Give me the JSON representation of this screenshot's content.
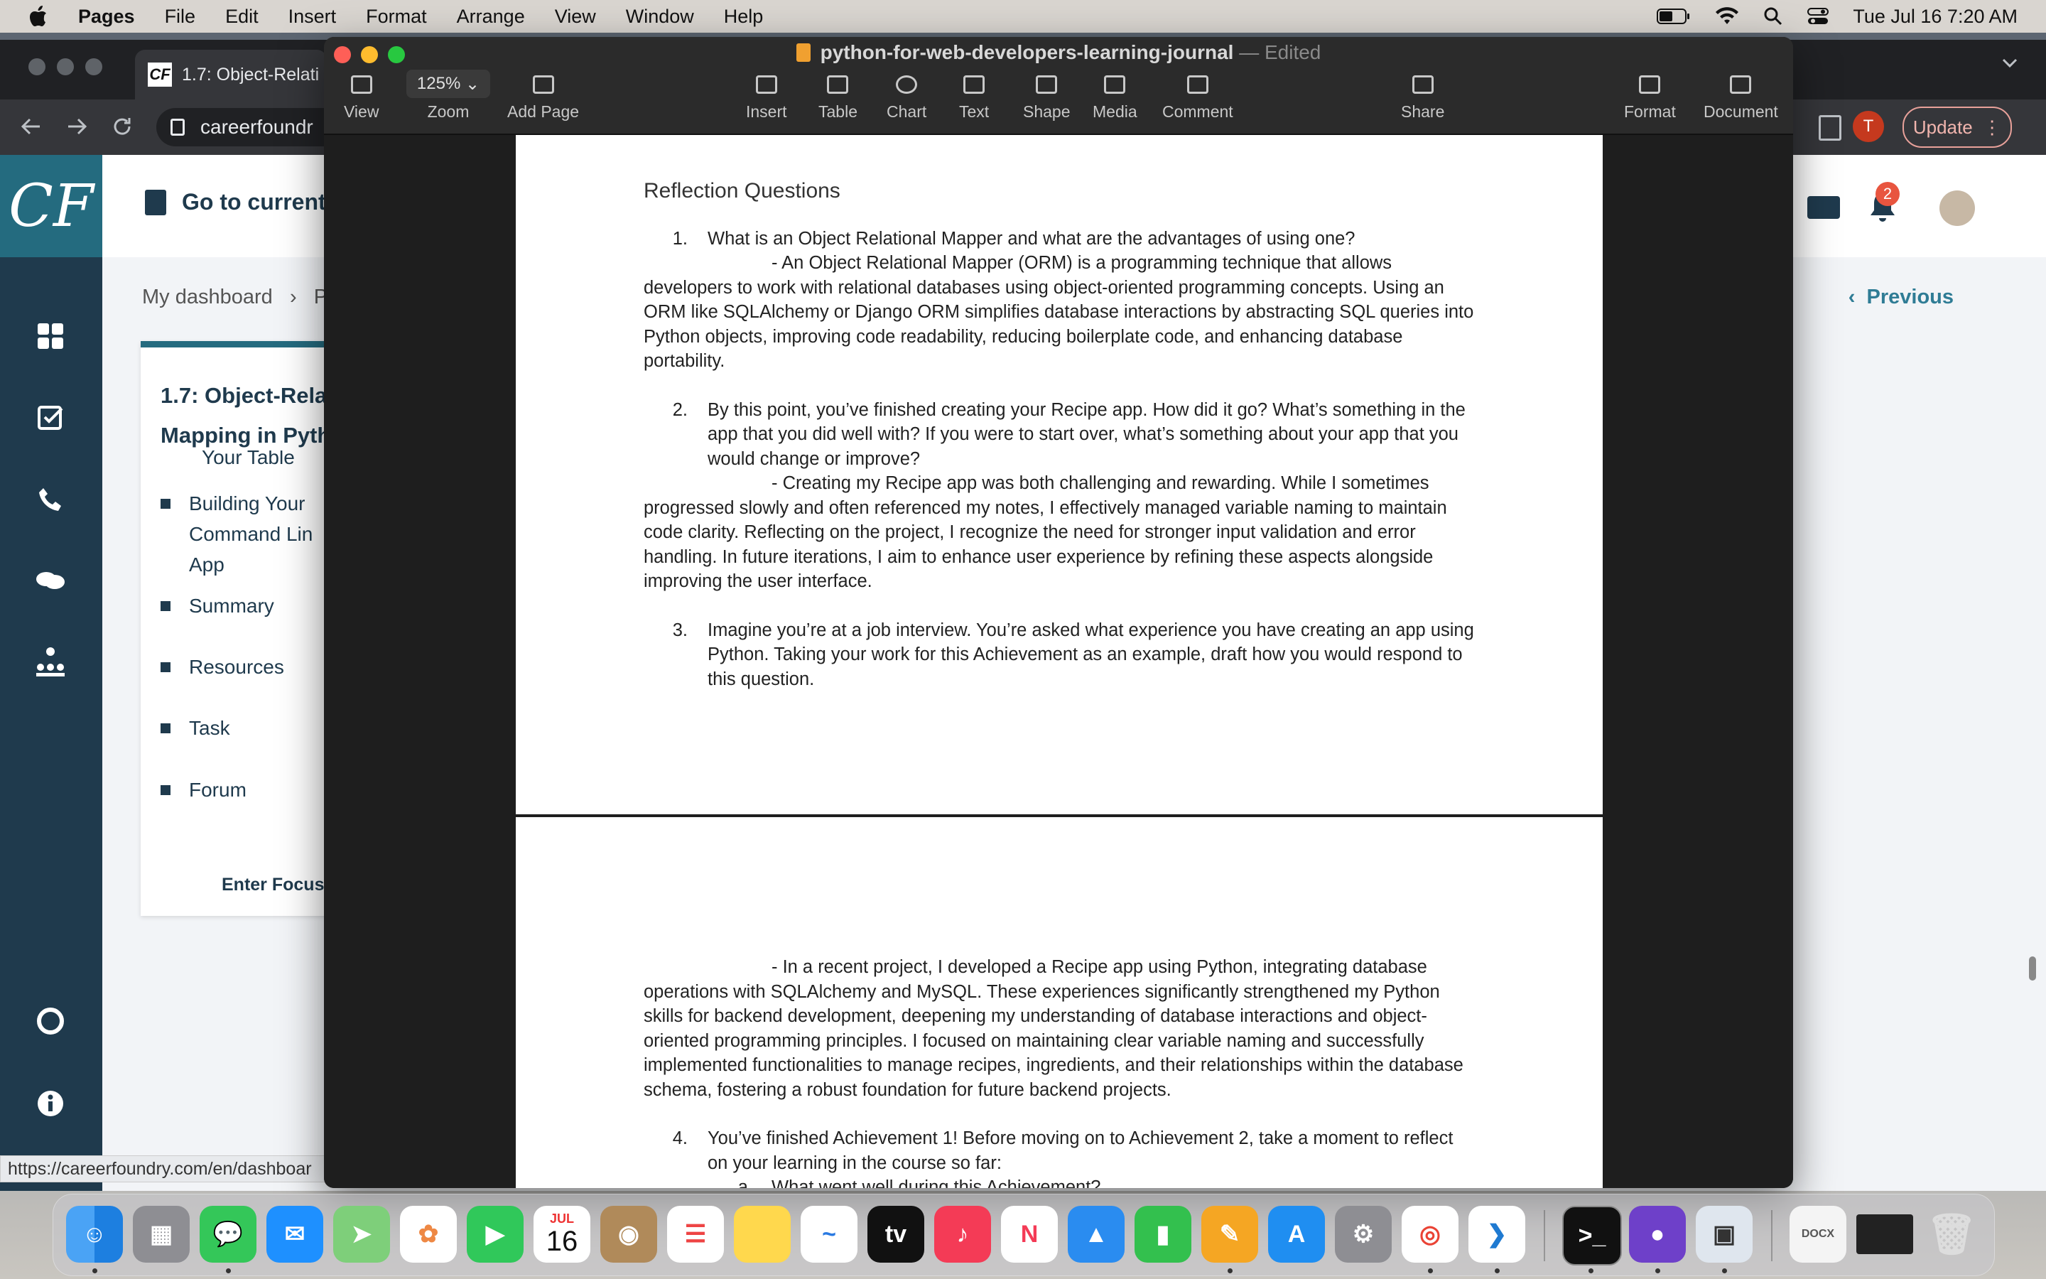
{
  "menubar": {
    "app": "Pages",
    "items": [
      "File",
      "Edit",
      "Insert",
      "Format",
      "Arrange",
      "View",
      "Window",
      "Help"
    ],
    "datetime": "Tue Jul 16  7:20 AM"
  },
  "browser": {
    "tab_title": "1.7: Object-Relati",
    "favicon": "CF",
    "url": "careerfoundr",
    "profile_initial": "T",
    "update_label": "Update",
    "status_url": "https://careerfoundry.com/en/dashboar"
  },
  "careerfoundry": {
    "logo": "CF",
    "go_to_current": "Go to current",
    "breadcrumb": "My dashboard",
    "breadcrumb_next": "P",
    "previous": "Previous",
    "notification_count": "2",
    "card_title": "1.7: Object-Rela Mapping in Pyth",
    "partial_item": "Your Table",
    "items": [
      {
        "label": "Building Your Command Lin App"
      },
      {
        "label": "Summary"
      },
      {
        "label": "Resources"
      },
      {
        "label": "Task"
      },
      {
        "label": "Forum"
      }
    ],
    "focus": "Enter Focus"
  },
  "pages": {
    "doc_name": "python-for-web-developers-learning-journal",
    "separator": "—",
    "status": "Edited",
    "toolbar": {
      "view": "View",
      "zoom_value": "125%",
      "zoom": "Zoom",
      "add_page": "Add Page",
      "insert": "Insert",
      "table": "Table",
      "chart": "Chart",
      "text": "Text",
      "shape": "Shape",
      "media": "Media",
      "comment": "Comment",
      "share": "Share",
      "format": "Format",
      "document": "Document"
    }
  },
  "document": {
    "heading": "Reflection Questions",
    "q1_num": "1.",
    "q1": "What is an Object Relational Mapper and what are the advantages of using one?",
    "a1": "- An Object Relational Mapper (ORM) is a programming technique that allows developers to work with relational databases using object-oriented programming concepts. Using an ORM like SQLAlchemy or Django ORM simplifies database interactions by abstracting SQL queries into Python objects, improving code readability, reducing boilerplate code, and enhancing database portability.",
    "q2_num": "2.",
    "q2": "By this point, you’ve finished creating your Recipe app. How did it go? What’s something in the app that you did well with? If you were to start over, what’s something about your app that you would change or improve?",
    "a2": "- Creating my Recipe app was both challenging and rewarding. While I sometimes progressed slowly and often referenced my notes, I effectively managed variable naming to maintain code clarity. Reflecting on the project, I recognize the need for stronger input validation and error handling. In future iterations, I aim to enhance user experience by refining these aspects alongside improving the user interface.",
    "q3_num": "3.",
    "q3": "Imagine you’re at a job interview. You’re asked what experience you have creating an app using Python. Taking your work for this Achievement as an example, draft how you would respond to this question.",
    "a3": "- In a recent project, I developed a Recipe app using Python, integrating database operations with SQLAlchemy and MySQL. These experiences significantly strengthened my Python skills for backend development, deepening my understanding of database interactions and object-oriented programming principles. I focused on maintaining clear variable naming and successfully implemented functionalities to manage recipes, ingredients, and their relationships within the database schema, fostering a robust foundation for future backend projects.",
    "q4_num": "4.",
    "q4": "You’ve finished Achievement 1! Before moving on to Achievement 2, take a moment to reflect on your learning in the course so far:",
    "q4a_letter": "a.",
    "q4a": "What went well during this Achievement?"
  },
  "dock": {
    "calendar_month": "JUL",
    "calendar_day": "16",
    "apps": [
      "finder-icon",
      "launchpad-icon",
      "messages-icon",
      "mail-icon",
      "maps-icon",
      "photos-icon",
      "facetime-icon",
      "calendar-icon",
      "contacts-icon",
      "reminders-icon",
      "notes-icon",
      "freeform-icon",
      "tv-icon",
      "music-icon",
      "news-icon",
      "keynote-icon",
      "numbers-icon",
      "pages-icon",
      "app-store-icon",
      "system-settings-icon",
      "chrome-icon",
      "vscode-icon",
      "terminal-icon",
      "github-icon",
      "preview-icon",
      "docx-file-icon",
      "screenshot-file-icon",
      "trash-icon"
    ]
  },
  "colors": {
    "cf_teal": "#246b7f",
    "cf_navy": "#1f3a4d",
    "link": "#2f7c95"
  }
}
